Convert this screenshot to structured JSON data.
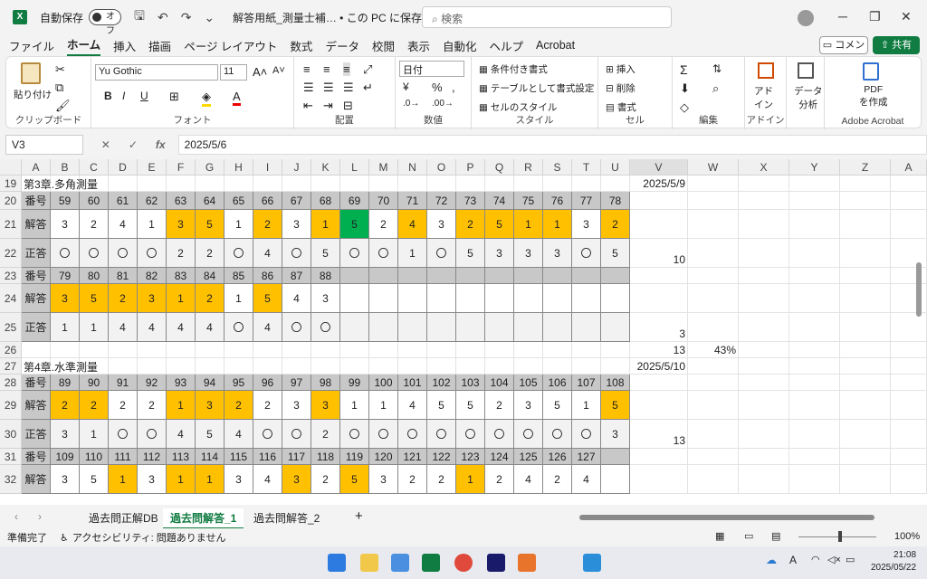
{
  "titlebar": {
    "app_icon": "excel-icon",
    "autosave_label": "自動保存",
    "autosave_state": "オフ",
    "doc_title": "解答用紙_測量士補… • この PC に保存済み",
    "search_placeholder": "検索"
  },
  "menu": [
    "ファイル",
    "ホーム",
    "挿入",
    "描画",
    "ページ レイアウト",
    "数式",
    "データ",
    "校閲",
    "表示",
    "自動化",
    "ヘルプ",
    "Acrobat"
  ],
  "menu_active": "ホーム",
  "comment_label": "コメント",
  "share_label": "共有",
  "ribbon": {
    "paste": "貼り付け",
    "clipboard": "クリップボード",
    "font_name": "Yu Gothic",
    "font_size": "11",
    "font_group": "フォント",
    "align_group": "配置",
    "number_format": "日付",
    "number_group": "数値",
    "cond_format": "条件付き書式",
    "table_format": "テーブルとして書式設定",
    "cell_style": "セルのスタイル",
    "style_group": "スタイル",
    "insert": "挿入",
    "delete": "削除",
    "format": "書式",
    "cells_group": "セル",
    "edit_group": "編集",
    "addin": "アド\nイン",
    "addin_group": "アドイン",
    "data_analysis": "データ\n分析",
    "pdf_create": "PDF\nを作成",
    "acrobat_group": "Adobe Acrobat"
  },
  "formula_bar": {
    "cell_ref": "V3",
    "formula": "2025/5/6"
  },
  "columns": [
    "A",
    "B",
    "C",
    "D",
    "E",
    "F",
    "G",
    "H",
    "I",
    "J",
    "K",
    "L",
    "M",
    "N",
    "O",
    "P",
    "Q",
    "R",
    "S",
    "T",
    "U",
    "V",
    "W",
    "X",
    "Y",
    "Z",
    "A"
  ],
  "rows": [
    "19",
    "20",
    "21",
    "22",
    "23",
    "24",
    "25",
    "26",
    "27",
    "28",
    "29",
    "30",
    "31",
    "32"
  ],
  "sheet": {
    "r19_title": "第3章.多角測量",
    "r19_date": "2025/5/9",
    "row_label_num": "番号",
    "row_label_ans": "解答",
    "row_label_cor": "正答",
    "r20_nums": [
      "59",
      "60",
      "61",
      "62",
      "63",
      "64",
      "65",
      "66",
      "67",
      "68",
      "69",
      "70",
      "71",
      "72",
      "73",
      "74",
      "75",
      "76",
      "77",
      "78"
    ],
    "r21_ans": [
      "3",
      "2",
      "4",
      "1",
      "3",
      "5",
      "1",
      "2",
      "3",
      "1",
      "5",
      "2",
      "4",
      "3",
      "2",
      "5",
      "1",
      "1",
      "3",
      "2"
    ],
    "r21_colors": [
      "w",
      "w",
      "w",
      "w",
      "y",
      "y",
      "w",
      "y",
      "w",
      "y",
      "g",
      "w",
      "y",
      "w",
      "y",
      "y",
      "y",
      "y",
      "w",
      "y"
    ],
    "r22_cor": [
      "〇",
      "〇",
      "〇",
      "〇",
      "2",
      "2",
      "〇",
      "4",
      "〇",
      "5",
      "〇",
      "〇",
      "1",
      "〇",
      "5",
      "3",
      "3",
      "3",
      "〇",
      "5"
    ],
    "r22_v": "10",
    "r23_nums": [
      "79",
      "80",
      "81",
      "82",
      "83",
      "84",
      "85",
      "86",
      "87",
      "88"
    ],
    "r24_ans": [
      "3",
      "5",
      "2",
      "3",
      "1",
      "2",
      "1",
      "5",
      "4",
      "3"
    ],
    "r24_colors": [
      "y",
      "y",
      "y",
      "y",
      "y",
      "y",
      "w",
      "y",
      "w",
      "w"
    ],
    "r25_cor": [
      "1",
      "1",
      "4",
      "4",
      "4",
      "4",
      "〇",
      "4",
      "〇",
      "〇"
    ],
    "r25_v": "3",
    "r26_v": "13",
    "r26_w": "43%",
    "r27_title": "第4章.水準測量",
    "r27_date": "2025/5/10",
    "r28_nums": [
      "89",
      "90",
      "91",
      "92",
      "93",
      "94",
      "95",
      "96",
      "97",
      "98",
      "99",
      "100",
      "101",
      "102",
      "103",
      "104",
      "105",
      "106",
      "107",
      "108"
    ],
    "r29_ans": [
      "2",
      "2",
      "2",
      "2",
      "1",
      "3",
      "2",
      "2",
      "3",
      "3",
      "1",
      "1",
      "4",
      "5",
      "5",
      "2",
      "3",
      "5",
      "1",
      "5"
    ],
    "r29_colors": [
      "y",
      "y",
      "w",
      "w",
      "y",
      "y",
      "y",
      "w",
      "w",
      "y",
      "w",
      "w",
      "w",
      "w",
      "w",
      "w",
      "w",
      "w",
      "w",
      "y"
    ],
    "r30_cor": [
      "3",
      "1",
      "〇",
      "〇",
      "4",
      "5",
      "4",
      "〇",
      "〇",
      "2",
      "〇",
      "〇",
      "〇",
      "〇",
      "〇",
      "〇",
      "〇",
      "〇",
      "〇",
      "3"
    ],
    "r30_v": "13",
    "r31_nums": [
      "109",
      "110",
      "111",
      "112",
      "113",
      "114",
      "115",
      "116",
      "117",
      "118",
      "119",
      "120",
      "121",
      "122",
      "123",
      "124",
      "125",
      "126",
      "127"
    ],
    "r32_ans": [
      "3",
      "5",
      "1",
      "3",
      "1",
      "1",
      "3",
      "4",
      "3",
      "2",
      "5",
      "3",
      "2",
      "2",
      "1",
      "2",
      "4",
      "2",
      "4"
    ],
    "r32_colors": [
      "w",
      "w",
      "y",
      "w",
      "y",
      "y",
      "w",
      "w",
      "y",
      "w",
      "y",
      "w",
      "w",
      "w",
      "y",
      "w",
      "w",
      "w",
      "w"
    ]
  },
  "tabs": [
    "過去問正解DB",
    "過去問解答_1",
    "過去問解答_2"
  ],
  "tab_active": "過去問解答_1",
  "status": {
    "ready": "準備完了",
    "accessibility": "アクセシビリティ: 問題ありません",
    "zoom": "100%"
  },
  "clock": {
    "time": "21:08",
    "date": "2025/05/22"
  },
  "colors": {
    "highlight": "#ffc000",
    "correct": "#00b050",
    "header": "#c8c8c8",
    "excel_green": "#107c41"
  }
}
